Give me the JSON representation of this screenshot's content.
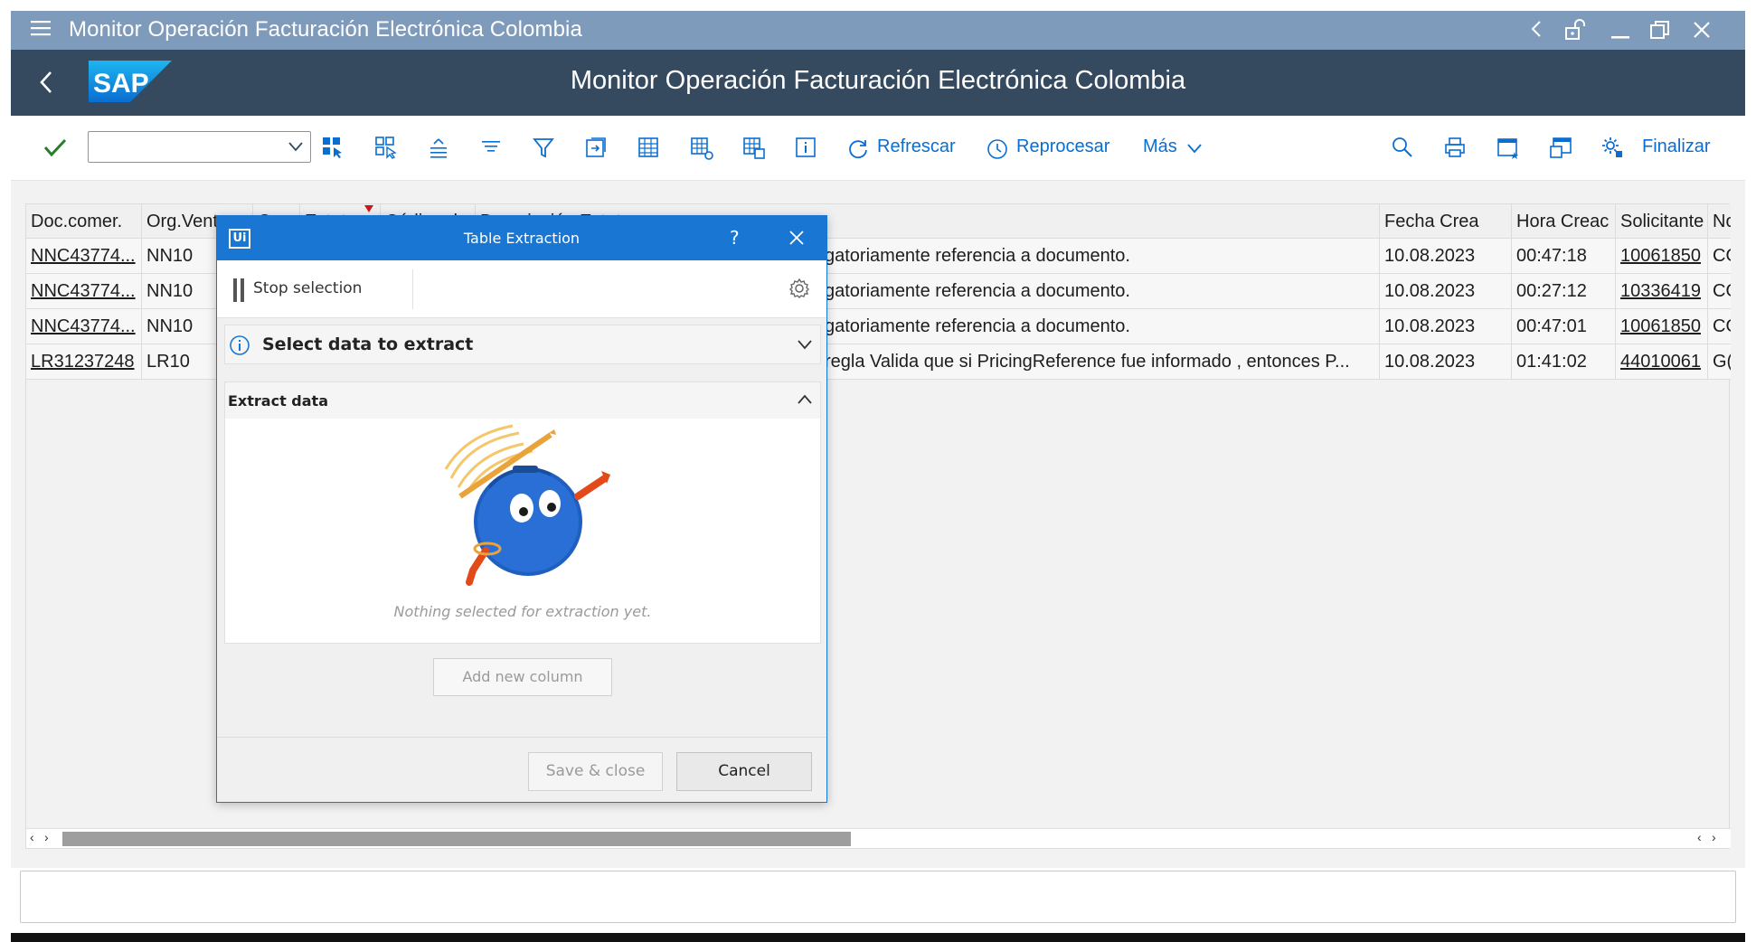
{
  "window": {
    "title": "Monitor Operación Facturación Electrónica Colombia"
  },
  "shell": {
    "logo_text": "SAP",
    "page_title": "Monitor Operación Facturación Electrónica Colombia"
  },
  "toolbar": {
    "refresh_label": "Refrescar",
    "reprocess_label": "Reprocesar",
    "more_label": "Más",
    "finish_label": "Finalizar",
    "command_value": ""
  },
  "grid": {
    "columns": [
      "Doc.comer.",
      "Org.Vent",
      "C",
      "Estat",
      "Código d",
      "Descripción Estat",
      "Fecha Crea",
      "Hora Creac",
      "Solicitante",
      "No"
    ],
    "rows": [
      {
        "doc": "NNC43774...",
        "org": "NN10",
        "desc": "gatoriamente referencia a documento.",
        "fecha": "10.08.2023",
        "hora": "00:47:18",
        "solicitante": "10061850",
        "no": "CO"
      },
      {
        "doc": "NNC43774...",
        "org": "NN10",
        "desc": "gatoriamente referencia a documento.",
        "fecha": "10.08.2023",
        "hora": "00:27:12",
        "solicitante": "10336419",
        "no": "CO"
      },
      {
        "doc": "NNC43774...",
        "org": "NN10",
        "desc": "gatoriamente referencia a documento.",
        "fecha": "10.08.2023",
        "hora": "00:47:01",
        "solicitante": "10061850",
        "no": "CO"
      },
      {
        "doc": "LR31237248",
        "org": "LR10",
        "desc": "regla Valida que si PricingReference fue informado , entonces P...",
        "fecha": "10.08.2023",
        "hora": "01:41:02",
        "solicitante": "44010061",
        "no": "G("
      }
    ]
  },
  "dialog": {
    "title": "Table Extraction",
    "logo_text": "Ui",
    "help": "?",
    "stop_selection": "Stop selection",
    "section_select": "Select data to extract",
    "section_extract": "Extract data",
    "empty_message": "Nothing selected for extraction yet.",
    "add_column": "Add new column",
    "save_close": "Save & close",
    "cancel": "Cancel"
  },
  "colors": {
    "title_bar": "#7f9bbb",
    "shell_bar": "#354a5f",
    "accent": "#0a6ed1",
    "dialog_header": "#1976d2"
  }
}
